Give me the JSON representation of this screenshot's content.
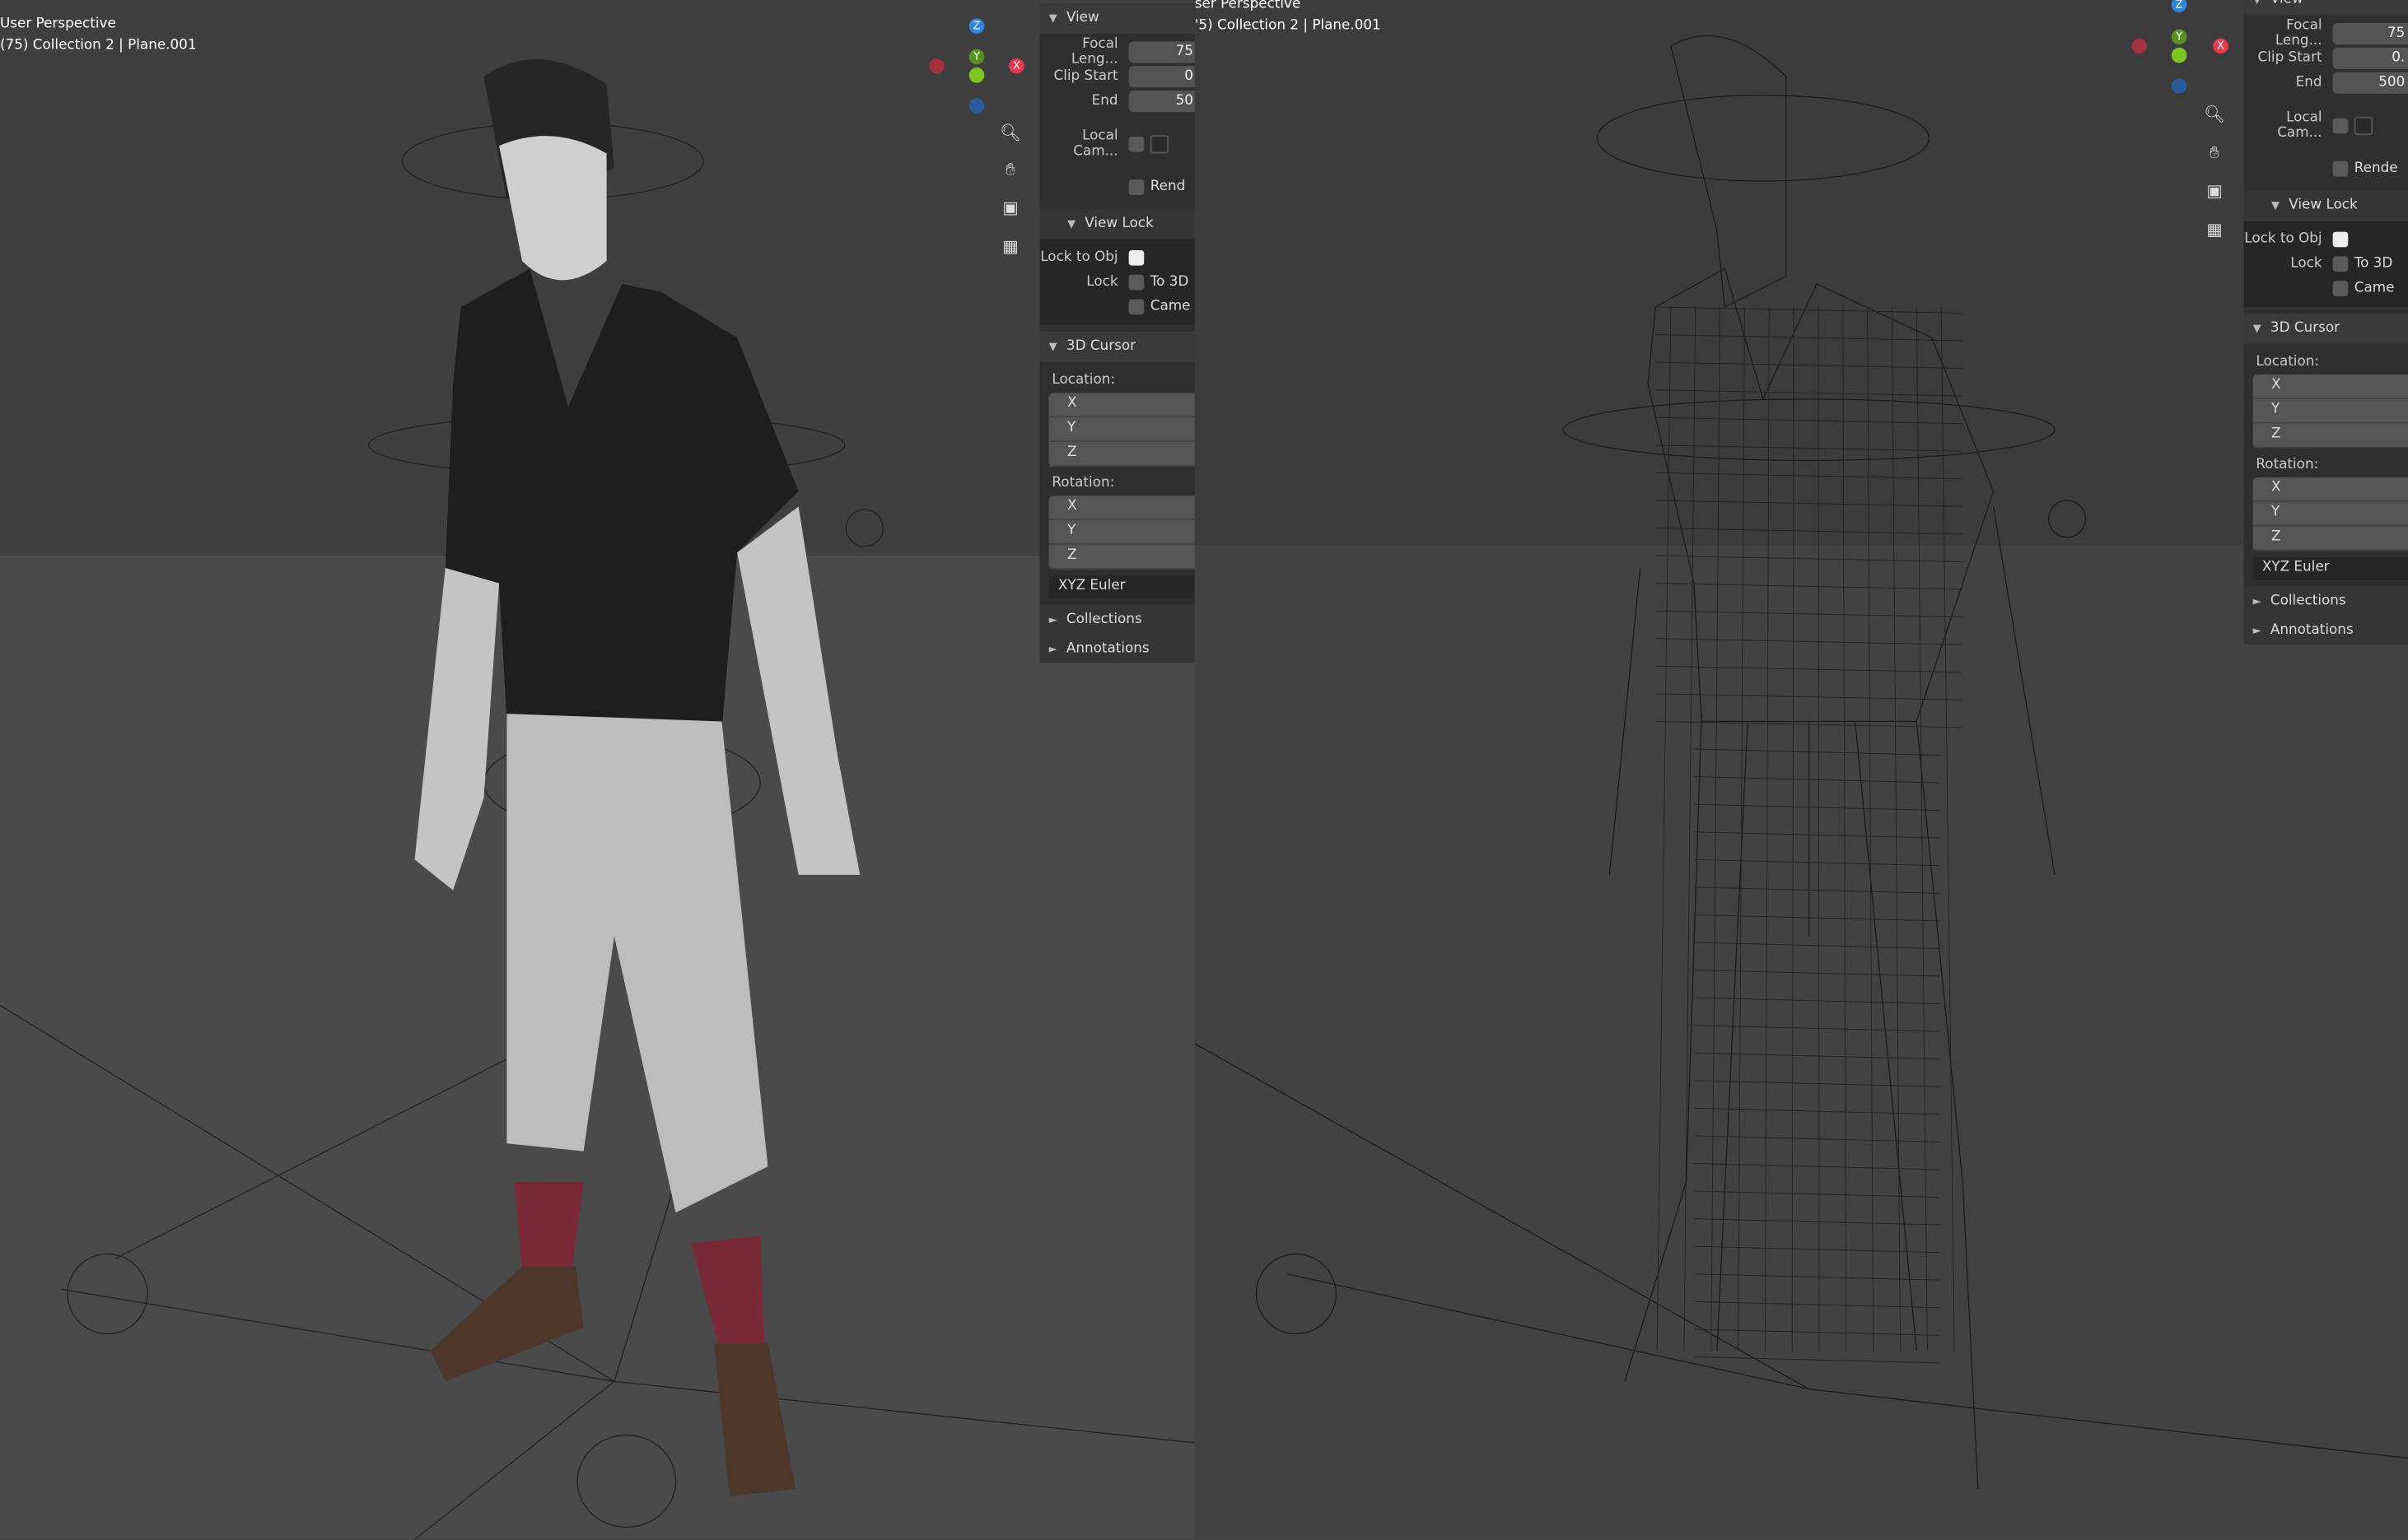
{
  "viewports": [
    {
      "perspective": "User Perspective",
      "object_info": "(75) Collection 2 | Plane.001",
      "shading": "solid"
    },
    {
      "perspective": "ser Perspective",
      "object_info": "'5) Collection 2 | Plane.001",
      "shading": "wireframe"
    }
  ],
  "gizmo": {
    "x": "X",
    "y": "Y",
    "z": "Z",
    "colors": {
      "x": "#e8394e",
      "y": "#7ec622",
      "z": "#2f86e0"
    }
  },
  "nav_icons": [
    "zoom-icon",
    "hand-pan-icon",
    "camera-icon",
    "grid-perspective-icon"
  ],
  "panels": [
    {
      "view": "View",
      "focal": "Focal Leng...",
      "focal_val": "75",
      "clip_start": "Clip Start",
      "clip_start_val": "0",
      "end": "End",
      "end_val": "50",
      "local_cam": "Local Cam...",
      "render": "Rend",
      "view_lock": "View Lock",
      "lock_obj": "Lock to Obj",
      "lock": "Lock",
      "to3d": "To 3D",
      "camera": "Came",
      "cursor": "3D Cursor",
      "location": "Location:",
      "rotation": "Rotation:",
      "x": "X",
      "y": "Y",
      "z": "Z",
      "euler": "XYZ Euler",
      "collections": "Collections",
      "annotations": "Annotations"
    },
    {
      "view": "View",
      "focal": "Focal Leng...",
      "focal_val": "75",
      "clip_start": "Clip Start",
      "clip_start_val": "0.",
      "end": "End",
      "end_val": "500",
      "local_cam": "Local Cam...",
      "render": "Rende",
      "view_lock": "View Lock",
      "lock_obj": "Lock to Obj",
      "lock": "Lock",
      "to3d": "To 3D",
      "camera": "Came",
      "cursor": "3D Cursor",
      "location": "Location:",
      "rotation": "Rotation:",
      "x": "X",
      "y": "Y",
      "z": "Z",
      "euler": "XYZ Euler",
      "collections": "Collections",
      "annotations": "Annotations"
    }
  ],
  "colors": {
    "shirt": "#1e1e1e",
    "pants": "#bdbdbd",
    "skin": "#c8c8c8",
    "socks": "#7a2a36",
    "shoes": "#4d372b",
    "wire": "#1a1a1a"
  }
}
